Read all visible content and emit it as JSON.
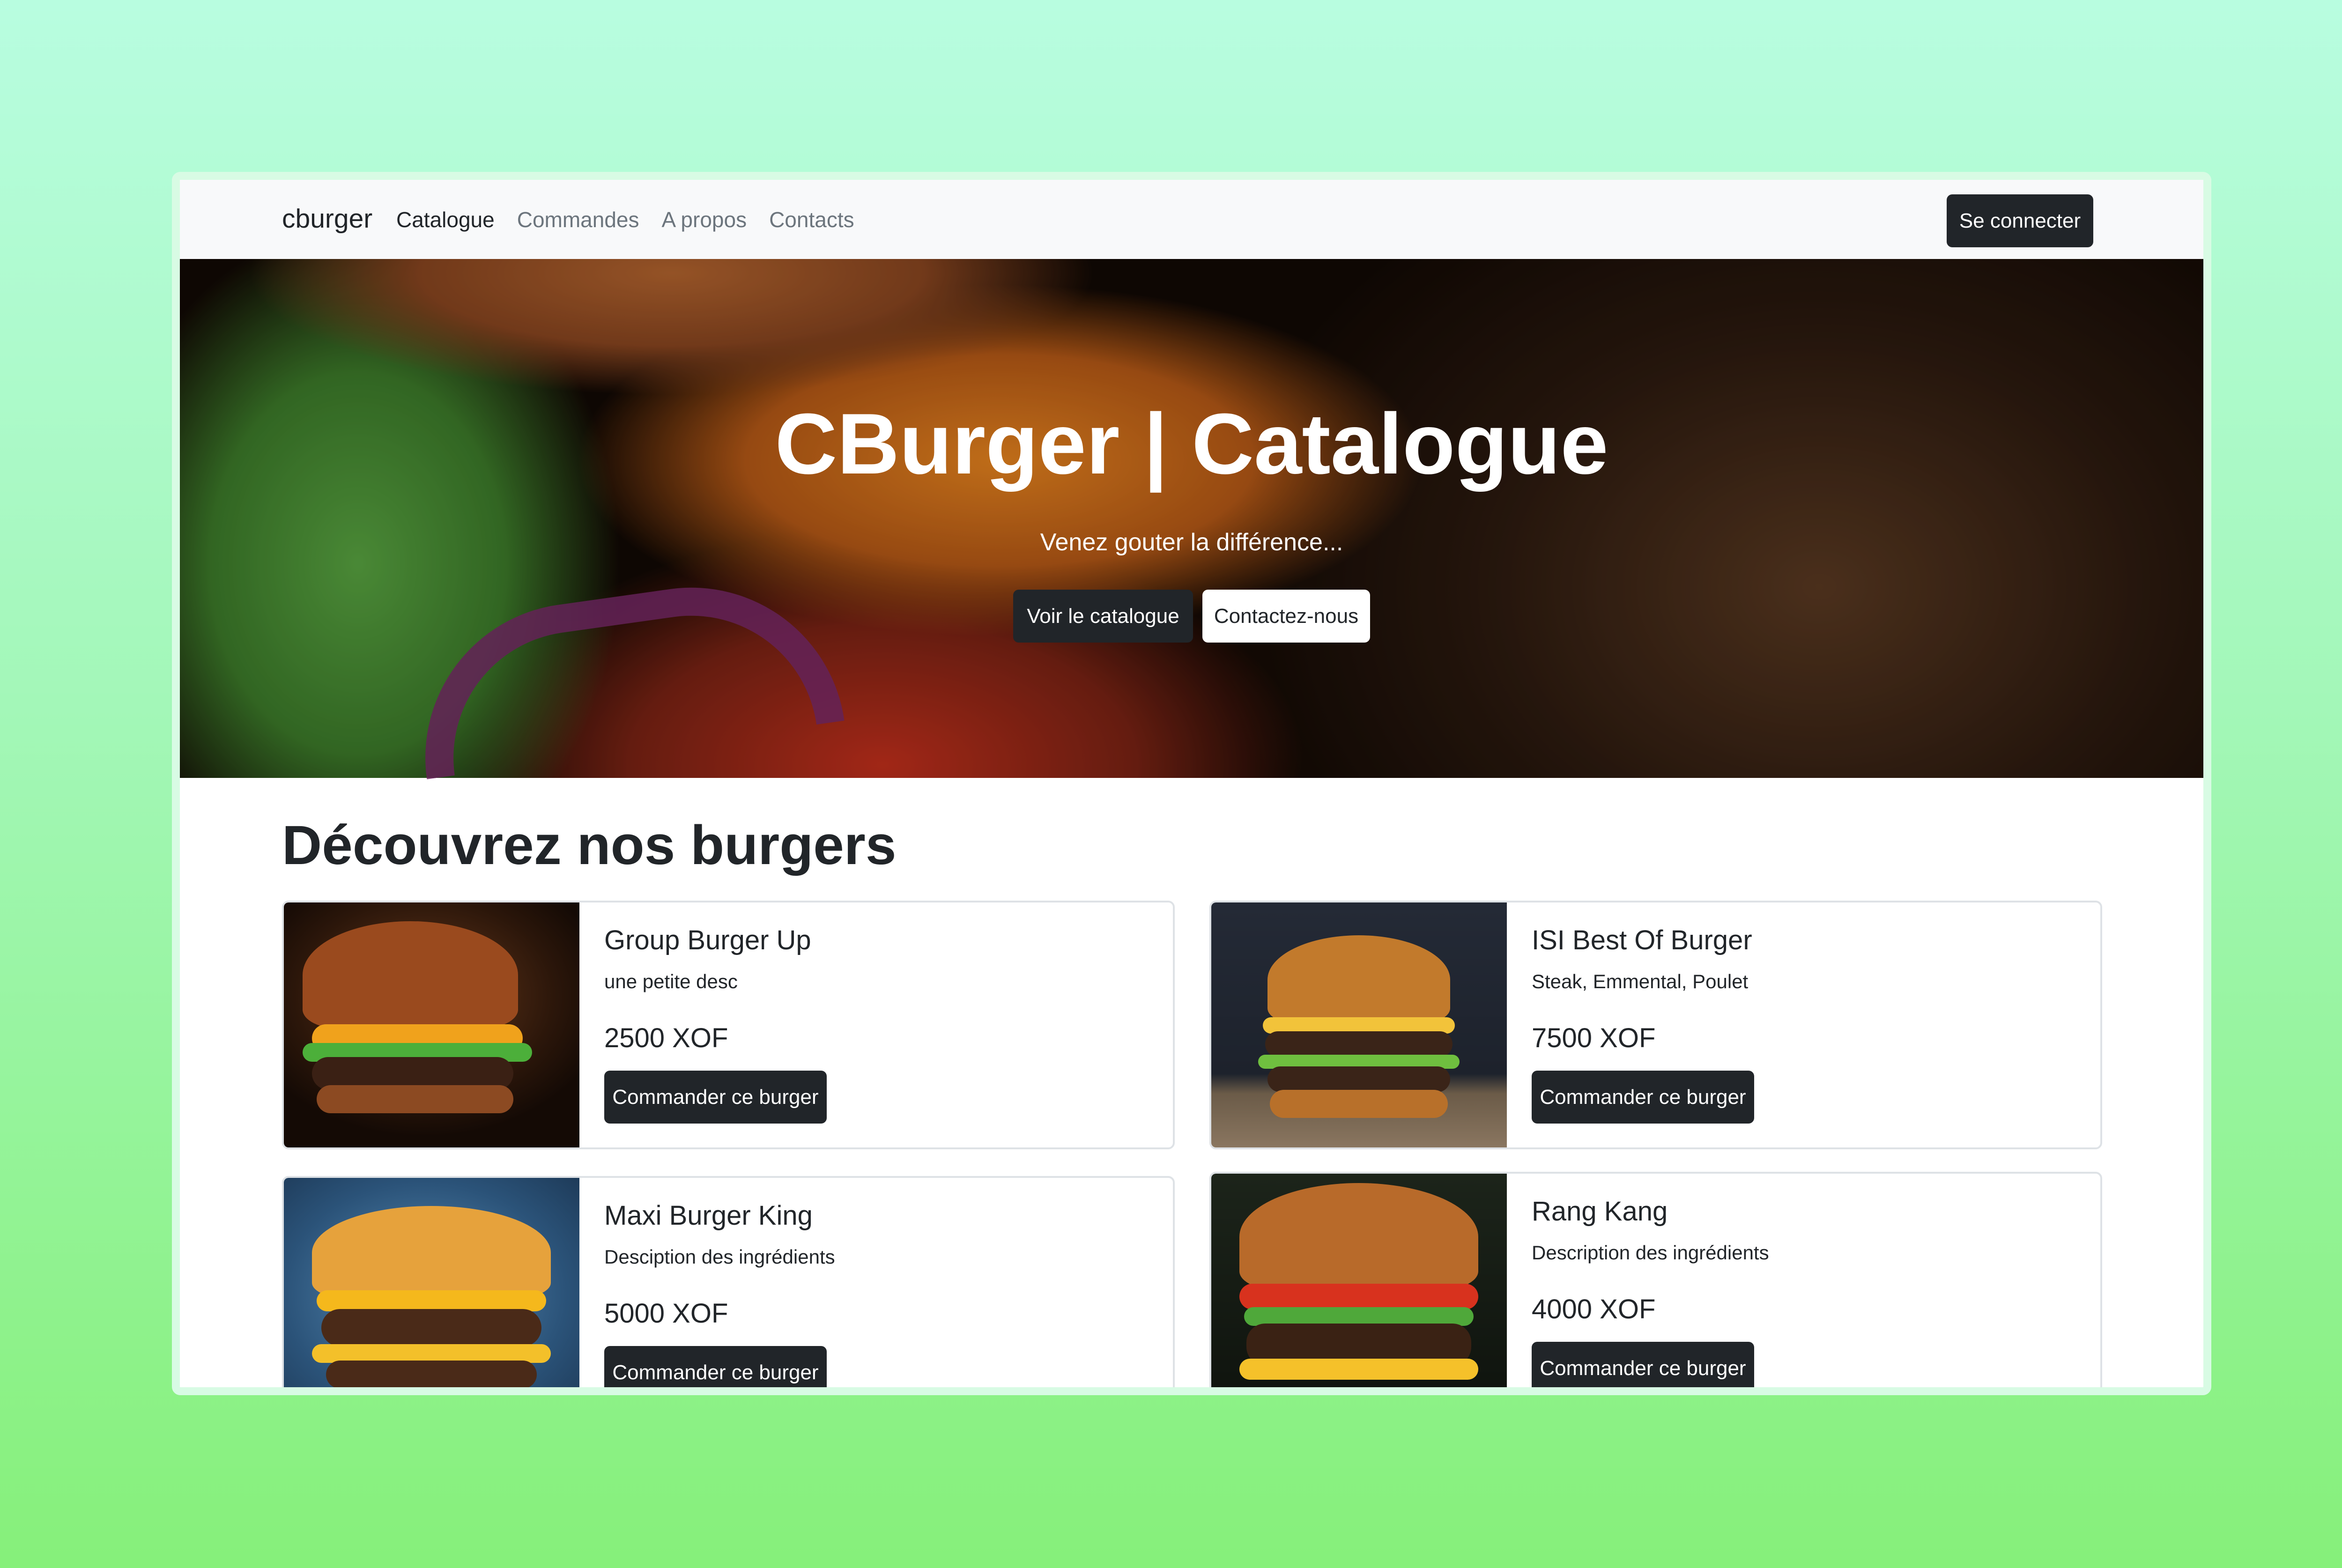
{
  "nav": {
    "brand": "cburger",
    "links": [
      "Catalogue",
      "Commandes",
      "A propos",
      "Contacts"
    ],
    "active": "Catalogue",
    "login_label": "Se connecter"
  },
  "hero": {
    "title": "CBurger | Catalogue",
    "subtitle": "Venez gouter la différence...",
    "primary_button": "Voir le catalogue",
    "secondary_button": "Contactez-nous"
  },
  "section": {
    "title": "Découvrez nos burgers"
  },
  "burgers": [
    {
      "name": "Group Burger Up",
      "description": "une petite desc",
      "price": "2500 XOF",
      "button": "Commander ce burger"
    },
    {
      "name": "ISI Best Of Burger",
      "description": "Steak, Emmental, Poulet",
      "price": "7500 XOF",
      "button": "Commander ce burger"
    },
    {
      "name": "Maxi Burger King",
      "description": "Desciption des ingrédients",
      "price": "5000 XOF",
      "button": "Commander ce burger"
    },
    {
      "name": "Rang Kang",
      "description": "Description des ingrédients",
      "price": "4000 XOF",
      "button": "Commander ce burger"
    }
  ],
  "colors": {
    "dark_button": "#212529",
    "navbar_bg": "#f8f9fa",
    "page_bg_top": "#b8fde0",
    "page_bg_bottom": "#86f07a"
  }
}
